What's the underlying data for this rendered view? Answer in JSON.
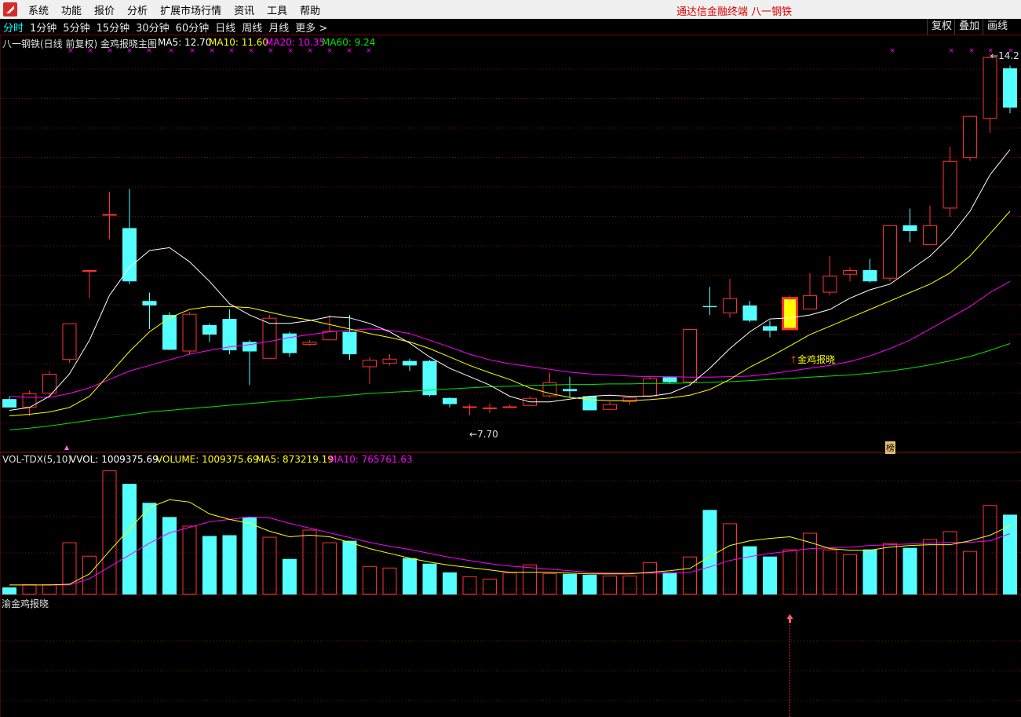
{
  "menu": {
    "items": [
      "系统",
      "功能",
      "报价",
      "分析",
      "扩展市场行情",
      "资讯",
      "工具",
      "帮助"
    ],
    "app_title": "通达信金融终端   八一钢铁"
  },
  "periods": {
    "items": [
      "分时",
      "1分钟",
      "5分钟",
      "15分钟",
      "30分钟",
      "60分钟",
      "日线",
      "周线",
      "月线",
      "更多 >"
    ],
    "active": "分时",
    "right_buttons": [
      "复权",
      "叠加",
      "画线"
    ]
  },
  "main_panel": {
    "title": "八一钢铁(日线 前复权) 金鸡报晓主图",
    "ma5_label": "MA5: 12.70",
    "ma10_label": "MA10: 11.60",
    "ma20_label": "MA20: 10.35",
    "ma60_label": "MA60: 9.24",
    "low_marker": "7.70",
    "high_marker": "14.2",
    "signal_label": "金鸡报晓",
    "tag_label": "榜"
  },
  "volume_panel": {
    "title": "VOL-TDX(5,10)",
    "vvol_label": "VVOL: 1009375.69",
    "volume_label": "VOLUME: 1009375.69",
    "ma5_label": "MA5: 873219.19",
    "ma10_label": "MA10: 765761.63"
  },
  "signal_panel": {
    "title": "渝金鸡报晓"
  },
  "colors": {
    "up": "#ff3232",
    "down": "#54ffff",
    "ma5": "#ffffff",
    "ma10": "#ffff00",
    "ma20": "#ff00ff",
    "ma60": "#00e600",
    "grid": "#7a1010",
    "signal": "#ffff00"
  },
  "chart_data": {
    "type": "candlestick",
    "price_range": [
      7.3,
      14.5
    ],
    "candles": [
      {
        "o": 8.25,
        "c": 8.1,
        "h": 8.3,
        "l": 8.1
      },
      {
        "o": 8.1,
        "c": 8.35,
        "h": 8.4,
        "l": 7.95
      },
      {
        "o": 8.35,
        "c": 8.7,
        "h": 8.75,
        "l": 8.3
      },
      {
        "o": 8.95,
        "c": 9.6,
        "h": 9.6,
        "l": 8.9
      },
      {
        "o": 10.55,
        "c": 10.55,
        "h": 10.55,
        "l": 10.05
      },
      {
        "o": 11.55,
        "c": 11.55,
        "h": 11.95,
        "l": 11.1
      },
      {
        "o": 11.3,
        "c": 10.35,
        "h": 12.0,
        "l": 10.3
      },
      {
        "o": 10.0,
        "c": 9.92,
        "h": 10.15,
        "l": 9.5
      },
      {
        "o": 9.75,
        "c": 9.13,
        "h": 9.8,
        "l": 9.12
      },
      {
        "o": 9.1,
        "c": 9.77,
        "h": 9.8,
        "l": 9.05
      },
      {
        "o": 9.57,
        "c": 9.4,
        "h": 9.6,
        "l": 9.27
      },
      {
        "o": 9.68,
        "c": 9.12,
        "h": 9.85,
        "l": 9.05
      },
      {
        "o": 9.27,
        "c": 9.1,
        "h": 9.3,
        "l": 8.5
      },
      {
        "o": 8.97,
        "c": 9.7,
        "h": 9.75,
        "l": 8.97
      },
      {
        "o": 9.42,
        "c": 9.07,
        "h": 9.45,
        "l": 9.0
      },
      {
        "o": 9.22,
        "c": 9.27,
        "h": 9.3,
        "l": 9.2
      },
      {
        "o": 9.3,
        "c": 9.47,
        "h": 9.75,
        "l": 9.3
      },
      {
        "o": 9.45,
        "c": 9.05,
        "h": 9.75,
        "l": 8.95
      },
      {
        "o": 8.82,
        "c": 8.95,
        "h": 9.0,
        "l": 8.52
      },
      {
        "o": 8.88,
        "c": 8.97,
        "h": 9.05,
        "l": 8.85
      },
      {
        "o": 8.93,
        "c": 8.85,
        "h": 8.97,
        "l": 8.75
      },
      {
        "o": 8.93,
        "c": 8.32,
        "h": 8.95,
        "l": 8.3
      },
      {
        "o": 8.27,
        "c": 8.16,
        "h": 8.28,
        "l": 8.1
      },
      {
        "o": 8.1,
        "c": 8.12,
        "h": 8.16,
        "l": 7.96
      },
      {
        "o": 8.1,
        "c": 8.1,
        "h": 8.17,
        "l": 8.0
      },
      {
        "o": 8.1,
        "c": 8.12,
        "h": 8.15,
        "l": 8.1
      },
      {
        "o": 8.13,
        "c": 8.27,
        "h": 8.3,
        "l": 8.13
      },
      {
        "o": 8.3,
        "c": 8.55,
        "h": 8.72,
        "l": 8.28
      },
      {
        "o": 8.43,
        "c": 8.39,
        "h": 8.65,
        "l": 8.28
      },
      {
        "o": 8.3,
        "c": 8.05,
        "h": 8.3,
        "l": 8.05
      },
      {
        "o": 8.06,
        "c": 8.16,
        "h": 8.2,
        "l": 8.05
      },
      {
        "o": 8.2,
        "c": 8.28,
        "h": 8.3,
        "l": 8.15
      },
      {
        "o": 8.3,
        "c": 8.62,
        "h": 8.66,
        "l": 8.28
      },
      {
        "o": 8.64,
        "c": 8.55,
        "h": 8.65,
        "l": 8.53
      },
      {
        "o": 8.55,
        "c": 9.5,
        "h": 9.5,
        "l": 8.5
      },
      {
        "o": 9.91,
        "c": 9.89,
        "h": 10.25,
        "l": 9.75
      },
      {
        "o": 9.78,
        "c": 10.05,
        "h": 10.4,
        "l": 9.7
      },
      {
        "o": 9.92,
        "c": 9.65,
        "h": 10.0,
        "l": 9.62
      },
      {
        "o": 9.55,
        "c": 9.47,
        "h": 9.65,
        "l": 9.35
      },
      {
        "o": 9.5,
        "c": 10.05,
        "h": 10.1,
        "l": 9.5
      },
      {
        "o": 9.85,
        "c": 10.1,
        "h": 10.5,
        "l": 9.85
      },
      {
        "o": 10.15,
        "c": 10.45,
        "h": 10.8,
        "l": 10.1
      },
      {
        "o": 10.47,
        "c": 10.55,
        "h": 10.6,
        "l": 10.35
      },
      {
        "o": 10.55,
        "c": 10.35,
        "h": 10.75,
        "l": 10.33
      },
      {
        "o": 10.4,
        "c": 11.35,
        "h": 11.35,
        "l": 10.35
      },
      {
        "o": 11.35,
        "c": 11.25,
        "h": 11.65,
        "l": 11.05
      },
      {
        "o": 11.0,
        "c": 11.35,
        "h": 11.7,
        "l": 11.0
      },
      {
        "o": 11.65,
        "c": 12.5,
        "h": 12.75,
        "l": 11.5
      },
      {
        "o": 12.55,
        "c": 13.3,
        "h": 13.3,
        "l": 12.5
      },
      {
        "o": 13.25,
        "c": 14.35,
        "h": 14.4,
        "l": 13.0
      },
      {
        "o": 14.15,
        "c": 13.45,
        "h": 14.2,
        "l": 13.35
      }
    ],
    "ma5": [
      8.05,
      8.1,
      8.3,
      8.7,
      9.3,
      10.1,
      10.6,
      10.9,
      10.95,
      10.7,
      10.35,
      9.95,
      9.75,
      9.6,
      9.6,
      9.65,
      9.72,
      9.7,
      9.6,
      9.45,
      9.25,
      9.0,
      8.8,
      8.65,
      8.5,
      8.3,
      8.2,
      8.2,
      8.25,
      8.3,
      8.32,
      8.3,
      8.3,
      8.35,
      8.5,
      8.8,
      9.15,
      9.45,
      9.68,
      9.7,
      9.75,
      9.85,
      10.05,
      10.2,
      10.3,
      10.55,
      10.8,
      11.15,
      11.6,
      12.25,
      12.7
    ],
    "ma10": [
      7.95,
      7.98,
      8.02,
      8.1,
      8.3,
      8.7,
      9.1,
      9.45,
      9.7,
      9.85,
      9.9,
      9.9,
      9.88,
      9.8,
      9.72,
      9.66,
      9.58,
      9.5,
      9.42,
      9.35,
      9.27,
      9.15,
      9.0,
      8.85,
      8.72,
      8.6,
      8.45,
      8.35,
      8.28,
      8.24,
      8.22,
      8.22,
      8.24,
      8.27,
      8.32,
      8.42,
      8.6,
      8.82,
      9.0,
      9.2,
      9.4,
      9.55,
      9.7,
      9.85,
      10.0,
      10.15,
      10.3,
      10.5,
      10.8,
      11.2,
      11.6
    ],
    "ma20": [
      8.3,
      8.28,
      8.28,
      8.35,
      8.45,
      8.6,
      8.75,
      8.85,
      8.95,
      9.05,
      9.12,
      9.18,
      9.22,
      9.28,
      9.35,
      9.4,
      9.45,
      9.48,
      9.5,
      9.48,
      9.42,
      9.3,
      9.18,
      9.05,
      8.95,
      8.88,
      8.83,
      8.78,
      8.73,
      8.7,
      8.68,
      8.66,
      8.65,
      8.65,
      8.64,
      8.64,
      8.65,
      8.66,
      8.7,
      8.75,
      8.8,
      8.85,
      8.92,
      9.02,
      9.15,
      9.3,
      9.5,
      9.7,
      9.9,
      10.15,
      10.35
    ],
    "ma60": [
      7.7,
      7.73,
      7.77,
      7.82,
      7.87,
      7.92,
      7.97,
      8.02,
      8.05,
      8.08,
      8.11,
      8.14,
      8.17,
      8.2,
      8.23,
      8.26,
      8.29,
      8.32,
      8.35,
      8.37,
      8.39,
      8.41,
      8.43,
      8.45,
      8.47,
      8.48,
      8.49,
      8.5,
      8.51,
      8.51,
      8.52,
      8.52,
      8.53,
      8.53,
      8.54,
      8.55,
      8.56,
      8.58,
      8.6,
      8.62,
      8.64,
      8.66,
      8.68,
      8.71,
      8.75,
      8.8,
      8.86,
      8.93,
      9.01,
      9.12,
      9.24
    ],
    "volume_range": [
      0,
      1.6
    ],
    "volume": [
      0.09,
      0.13,
      0.13,
      0.66,
      0.49,
      1.57,
      1.4,
      1.16,
      0.98,
      0.87,
      0.74,
      0.75,
      0.98,
      0.73,
      0.45,
      0.82,
      0.66,
      0.68,
      0.36,
      0.34,
      0.46,
      0.39,
      0.28,
      0.23,
      0.2,
      0.28,
      0.38,
      0.27,
      0.26,
      0.25,
      0.24,
      0.24,
      0.41,
      0.28,
      0.48,
      1.07,
      0.9,
      0.61,
      0.48,
      0.57,
      0.78,
      0.57,
      0.51,
      0.57,
      0.65,
      0.59,
      0.7,
      0.8,
      0.55,
      1.13,
      1.01
    ],
    "vol_ma5": [
      0.12,
      0.12,
      0.12,
      0.13,
      0.26,
      0.55,
      0.83,
      1.1,
      1.2,
      1.17,
      1.02,
      0.95,
      0.9,
      0.8,
      0.73,
      0.75,
      0.73,
      0.66,
      0.58,
      0.52,
      0.46,
      0.41,
      0.37,
      0.34,
      0.31,
      0.28,
      0.28,
      0.28,
      0.27,
      0.26,
      0.26,
      0.26,
      0.28,
      0.3,
      0.33,
      0.48,
      0.62,
      0.68,
      0.71,
      0.73,
      0.66,
      0.58,
      0.56,
      0.56,
      0.6,
      0.62,
      0.63,
      0.63,
      0.68,
      0.75,
      0.87
    ],
    "vol_ma10": [
      0.12,
      0.12,
      0.12,
      0.12,
      0.2,
      0.35,
      0.5,
      0.65,
      0.78,
      0.85,
      0.92,
      0.95,
      0.98,
      0.97,
      0.9,
      0.84,
      0.78,
      0.72,
      0.66,
      0.61,
      0.57,
      0.52,
      0.47,
      0.43,
      0.39,
      0.36,
      0.34,
      0.32,
      0.3,
      0.28,
      0.27,
      0.27,
      0.27,
      0.27,
      0.28,
      0.35,
      0.43,
      0.48,
      0.52,
      0.55,
      0.58,
      0.59,
      0.6,
      0.62,
      0.63,
      0.64,
      0.65,
      0.66,
      0.66,
      0.68,
      0.77
    ],
    "signal_index": 39
  }
}
